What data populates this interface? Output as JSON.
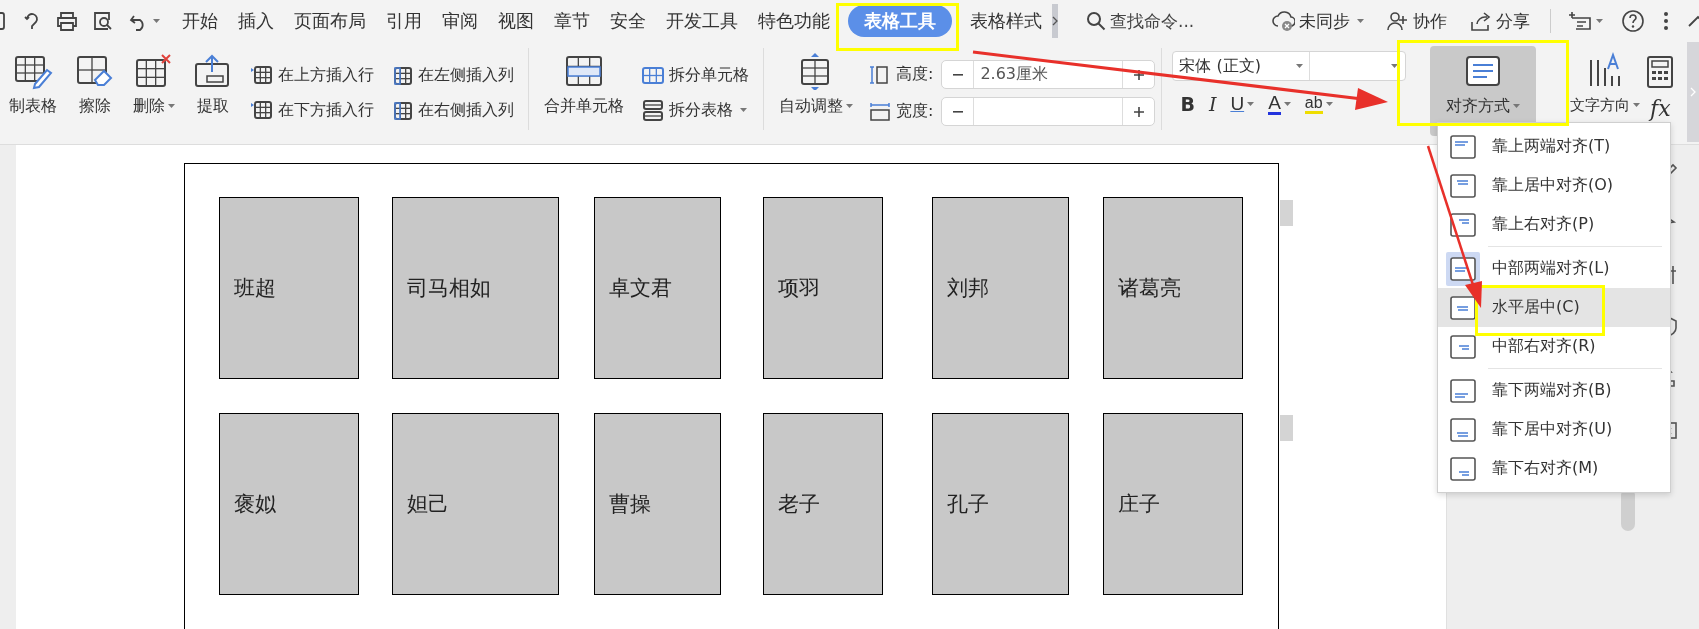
{
  "menu_tabs": [
    {
      "label": "开始",
      "selected": false
    },
    {
      "label": "插入",
      "selected": false
    },
    {
      "label": "页面布局",
      "selected": false
    },
    {
      "label": "引用",
      "selected": false
    },
    {
      "label": "审阅",
      "selected": false
    },
    {
      "label": "视图",
      "selected": false
    },
    {
      "label": "章节",
      "selected": false
    },
    {
      "label": "安全",
      "selected": false
    },
    {
      "label": "开发工具",
      "selected": false
    },
    {
      "label": "特色功能",
      "selected": false
    },
    {
      "label": "表格工具",
      "selected": true
    },
    {
      "label": "表格样式",
      "selected": false
    }
  ],
  "search": {
    "placeholder": "查找命令..."
  },
  "top_actions": [
    {
      "label": "未同步",
      "dropdown": true
    },
    {
      "label": "协作",
      "dropdown": false
    },
    {
      "label": "分享",
      "dropdown": false
    }
  ],
  "ribbon": [
    {
      "kind": "large",
      "label": "制表格",
      "dropdown": false,
      "pressed": false
    },
    {
      "kind": "large",
      "label": "擦除",
      "dropdown": false,
      "pressed": false
    },
    {
      "kind": "large",
      "label": "删除",
      "dropdown": true,
      "pressed": false
    },
    {
      "kind": "large",
      "label": "提取",
      "dropdown": false,
      "pressed": false
    },
    {
      "kind": "stack",
      "items": [
        {
          "label": "在上方插入行",
          "dropdown": false
        },
        {
          "label": "在下方插入行",
          "dropdown": false
        }
      ]
    },
    {
      "kind": "stack",
      "items": [
        {
          "label": "在左侧插入列",
          "dropdown": false
        },
        {
          "label": "在右侧插入列",
          "dropdown": false
        }
      ]
    },
    {
      "kind": "separator"
    },
    {
      "kind": "large",
      "label": "合并单元格",
      "dropdown": false,
      "pressed": false
    },
    {
      "kind": "stack",
      "items": [
        {
          "label": "拆分单元格",
          "dropdown": false
        },
        {
          "label": "拆分表格",
          "dropdown": true
        }
      ]
    },
    {
      "kind": "separator"
    },
    {
      "kind": "large",
      "label": "自动调整",
      "dropdown": true,
      "pressed": false
    },
    {
      "kind": "size",
      "rows": [
        {
          "label": "高度:",
          "value": "2.63厘米"
        },
        {
          "label": "宽度:"
        }
      ]
    },
    {
      "kind": "separator"
    },
    {
      "kind": "font",
      "font_name": "宋体 (正文)",
      "format_buttons": [
        {
          "label": "B",
          "dropdown": false
        },
        {
          "label": "I",
          "dropdown": false
        },
        {
          "label": "U",
          "dropdown": true
        },
        {
          "label": "A",
          "dropdown": true
        },
        {
          "label": "ab",
          "dropdown": true
        }
      ]
    },
    {
      "kind": "large",
      "label": "对齐方式",
      "dropdown": true,
      "pressed": true
    },
    {
      "kind": "large",
      "label": "文字方向",
      "dropdown": true,
      "pressed": false
    },
    {
      "kind": "formula",
      "label": "fx"
    }
  ],
  "align_menu": [
    [
      {
        "label": "靠上两端对齐(T)",
        "current": false,
        "hovered": false
      },
      {
        "label": "靠上居中对齐(O)",
        "current": false,
        "hovered": false
      },
      {
        "label": "靠上右对齐(P)",
        "current": false,
        "hovered": false
      }
    ],
    [
      {
        "label": "中部两端对齐(L)",
        "current": true,
        "hovered": false
      },
      {
        "label": "水平居中(C)",
        "current": false,
        "hovered": true
      },
      {
        "label": "中部右对齐(R)",
        "current": false,
        "hovered": false
      }
    ],
    [
      {
        "label": "靠下两端对齐(B)",
        "current": false,
        "hovered": false
      },
      {
        "label": "靠下居中对齐(U)",
        "current": false,
        "hovered": false
      },
      {
        "label": "靠下右对齐(M)",
        "current": false,
        "hovered": false
      }
    ]
  ],
  "table": {
    "rows": [
      [
        "班超",
        "司马相如",
        "卓文君",
        "项羽",
        "刘邦",
        "诸葛亮"
      ],
      [
        "褒姒",
        "妲己",
        "曹操",
        "老子",
        "孔子",
        "庄子"
      ]
    ]
  }
}
